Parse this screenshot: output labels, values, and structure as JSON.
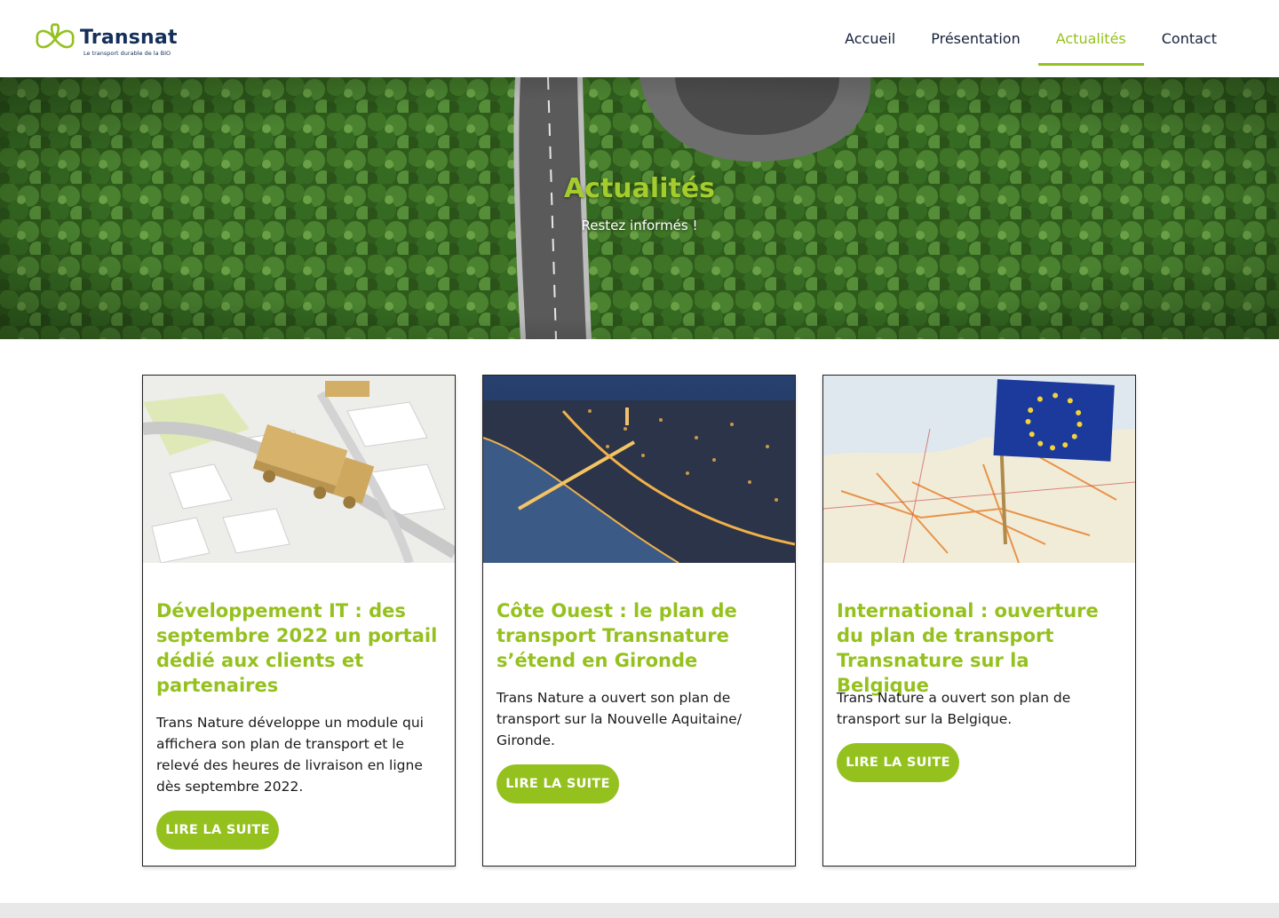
{
  "header": {
    "logo_name": "Transnat",
    "logo_tagline": "Le transport durable de la BIO",
    "nav": [
      {
        "label": "Accueil"
      },
      {
        "label": "Présentation"
      },
      {
        "label": "Actualités",
        "active": true
      },
      {
        "label": "Contact"
      }
    ]
  },
  "hero": {
    "title": "Actualités",
    "subtitle": "Restez informés !"
  },
  "cards": [
    {
      "image": "truck-map-image",
      "title": "Développement IT : des septembre 2022 un portail dédié aux clients et partenaires",
      "text": "Trans Nature développe un module qui affichera son plan de transport et le relevé des heures de livraison en ligne dès septembre 2022.",
      "button": "LIRE LA SUITE"
    },
    {
      "image": "bordeaux-night-image",
      "title": "Côte Ouest : le plan de transport Transnature s’étend en Gironde",
      "text": "Trans Nature a ouvert son plan de transport sur la Nouvelle Aquitaine/ Gironde.",
      "button": "LIRE LA SUITE"
    },
    {
      "image": "eu-flag-map-image",
      "title": "International : ouverture du plan de transport Transnature sur la Belgique",
      "text": "Trans Nature a ouvert son plan de transport sur la Belgique.",
      "button": "LIRE LA SUITE"
    }
  ],
  "colors": {
    "accent": "#95c11f",
    "navy": "#14305a"
  }
}
